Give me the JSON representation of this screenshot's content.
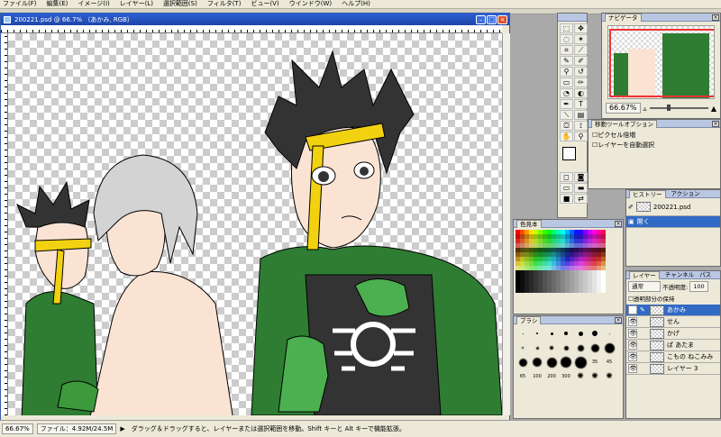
{
  "menu": [
    "ファイル(F)",
    "編集(E)",
    "イメージ(I)",
    "レイヤー(L)",
    "選択範囲(S)",
    "フィルタ(T)",
    "ビュー(V)",
    "ウインドウ(W)",
    "ヘルプ(H)"
  ],
  "document": {
    "title": "200221.psd @ 66.7% （あかみ, RGB）",
    "zoom": "66.67%",
    "file_info": "ファイル：4.92M/24.5M",
    "status_hint": "ダラッグ＆ドラッグすると、レイヤーまたは選択範囲を移動。Shift キーと Alt キーで機能拡張。"
  },
  "navigator": {
    "title": "ナビゲータ",
    "zoom": "66.67%"
  },
  "move_options": {
    "title": "移動ツールオプション",
    "options": [
      "ピクセル倍増",
      "レイヤーを自動選択"
    ]
  },
  "history": {
    "tabs": [
      "ヒストリー",
      "アクション"
    ],
    "snapshot": "200221.psd",
    "item": "開く"
  },
  "swatches": {
    "title": "色見本"
  },
  "brushes": {
    "title": "ブラシ",
    "sizes": [
      "35",
      "45",
      "65",
      "100",
      "200",
      "300"
    ]
  },
  "layers": {
    "tabs": [
      "レイヤー",
      "チャンネル",
      "パス"
    ],
    "mode": "通常",
    "opacity_label": "不透明度:",
    "opacity": "100",
    "preserve": "透明部分の保持",
    "items": [
      {
        "name": "あかみ",
        "selected": true
      },
      {
        "name": "せん",
        "selected": false
      },
      {
        "name": "かげ",
        "selected": false
      },
      {
        "name": "ぱ あたま",
        "selected": false
      },
      {
        "name": "こもの ねこみみ",
        "selected": false
      },
      {
        "name": "レイヤー 3",
        "selected": false
      }
    ]
  },
  "colors": {
    "titlebar": "#1e46a8",
    "skin": "#fbe3d4",
    "green": "#2e7d32",
    "yellow": "#f2d210"
  }
}
